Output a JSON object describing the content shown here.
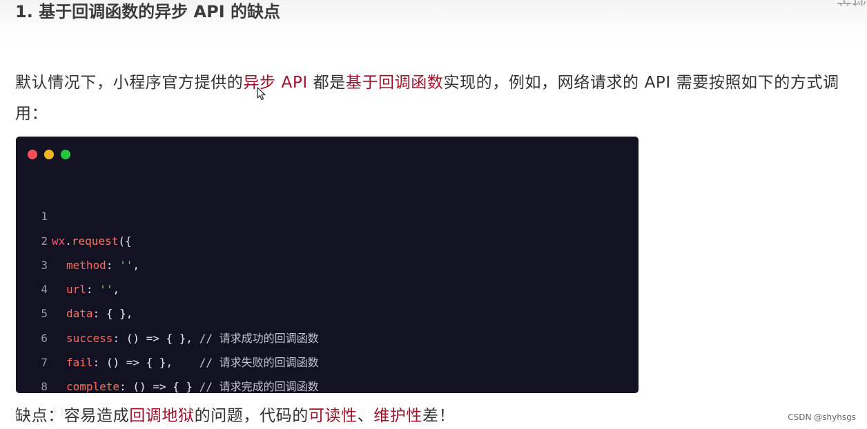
{
  "heading": "1. 基于回调函数的异步 API 的缺点",
  "corner_fragment": "文档",
  "paragraph": {
    "part1": "默认情况下，小程序官方提供的",
    "hl1": "异步 API",
    "part2": " 都是",
    "hl2": "基于回调函数",
    "part3": "实现的，例如，网络请求的 API 需要按照如下的方式调用："
  },
  "code_window": {
    "dot_colors": [
      "#f4515b",
      "#f2b628",
      "#27c53f"
    ],
    "line_numbers": [
      "1",
      "2",
      "3",
      "4",
      "5",
      "6",
      "7",
      "8"
    ],
    "tokens": {
      "obj": "wx",
      "dot": ".",
      "fn": "request",
      "open": "({",
      "k_method": "method",
      "k_url": "url",
      "k_data": "data",
      "k_success": "success",
      "k_fail": "fail",
      "k_complete": "complete",
      "colon": ":",
      "str_empty": "''",
      "comma": ",",
      "obj_empty": "{ }",
      "arrow_fn": "() => { }",
      "comment_prefix": "//",
      "comment_success": "请求成功的回调函数",
      "comment_fail": "请求失败的回调函数",
      "comment_complete": "请求完成的回调函数",
      "close": "})"
    }
  },
  "drawback": {
    "part1": "缺点：容易造成",
    "hl1": "回调地狱",
    "part2": "的问题，代码的",
    "hl2": "可读性",
    "part3": "、",
    "hl3": "维护性",
    "part4": "差！"
  },
  "watermark": "CSDN @shyhsgs",
  "colors": {
    "highlight": "#a0132c",
    "code_background": "#121223",
    "text": "#333333"
  }
}
